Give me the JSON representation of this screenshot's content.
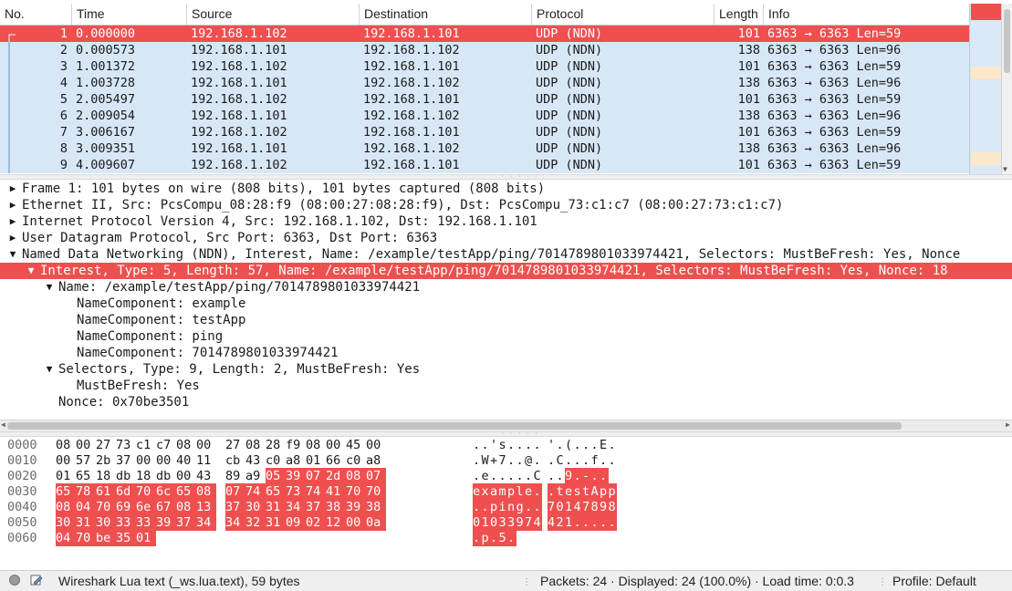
{
  "packet_list": {
    "columns": [
      "No.",
      "Time",
      "Source",
      "Destination",
      "Protocol",
      "Length",
      "Info"
    ],
    "rows": [
      {
        "no": "1",
        "time": "0.000000",
        "src": "192.168.1.102",
        "dst": "192.168.1.101",
        "proto": "UDP (NDN)",
        "len": "101",
        "info": "6363 → 6363 Len=59",
        "selected": true
      },
      {
        "no": "2",
        "time": "0.000573",
        "src": "192.168.1.101",
        "dst": "192.168.1.102",
        "proto": "UDP (NDN)",
        "len": "138",
        "info": "6363 → 6363 Len=96",
        "selected": false
      },
      {
        "no": "3",
        "time": "1.001372",
        "src": "192.168.1.102",
        "dst": "192.168.1.101",
        "proto": "UDP (NDN)",
        "len": "101",
        "info": "6363 → 6363 Len=59",
        "selected": false
      },
      {
        "no": "4",
        "time": "1.003728",
        "src": "192.168.1.101",
        "dst": "192.168.1.102",
        "proto": "UDP (NDN)",
        "len": "138",
        "info": "6363 → 6363 Len=96",
        "selected": false
      },
      {
        "no": "5",
        "time": "2.005497",
        "src": "192.168.1.102",
        "dst": "192.168.1.101",
        "proto": "UDP (NDN)",
        "len": "101",
        "info": "6363 → 6363 Len=59",
        "selected": false
      },
      {
        "no": "6",
        "time": "2.009054",
        "src": "192.168.1.101",
        "dst": "192.168.1.102",
        "proto": "UDP (NDN)",
        "len": "138",
        "info": "6363 → 6363 Len=96",
        "selected": false
      },
      {
        "no": "7",
        "time": "3.006167",
        "src": "192.168.1.102",
        "dst": "192.168.1.101",
        "proto": "UDP (NDN)",
        "len": "101",
        "info": "6363 → 6363 Len=59",
        "selected": false
      },
      {
        "no": "8",
        "time": "3.009351",
        "src": "192.168.1.101",
        "dst": "192.168.1.102",
        "proto": "UDP (NDN)",
        "len": "138",
        "info": "6363 → 6363 Len=96",
        "selected": false
      },
      {
        "no": "9",
        "time": "4.009607",
        "src": "192.168.1.102",
        "dst": "192.168.1.101",
        "proto": "UDP (NDN)",
        "len": "101",
        "info": "6363 → 6363 Len=59",
        "selected": false
      }
    ]
  },
  "details": {
    "items": [
      {
        "text": "Frame 1: 101 bytes on wire (808 bits), 101 bytes captured (808 bits)",
        "level": 0,
        "state": "collapsed",
        "selected": false
      },
      {
        "text": "Ethernet II, Src: PcsCompu_08:28:f9 (08:00:27:08:28:f9), Dst: PcsCompu_73:c1:c7 (08:00:27:73:c1:c7)",
        "level": 0,
        "state": "collapsed",
        "selected": false
      },
      {
        "text": "Internet Protocol Version 4, Src: 192.168.1.102, Dst: 192.168.1.101",
        "level": 0,
        "state": "collapsed",
        "selected": false
      },
      {
        "text": "User Datagram Protocol, Src Port: 6363, Dst Port: 6363",
        "level": 0,
        "state": "collapsed",
        "selected": false
      },
      {
        "text": "Named Data Networking (NDN), Interest, Name: /example/testApp/ping/7014789801033974421, Selectors: MustBeFresh: Yes, Nonce",
        "level": 0,
        "state": "expanded",
        "selected": false
      },
      {
        "text": "Interest, Type: 5, Length: 57, Name: /example/testApp/ping/7014789801033974421, Selectors: MustBeFresh: Yes, Nonce: 18",
        "level": 1,
        "state": "expanded",
        "selected": true
      },
      {
        "text": "Name: /example/testApp/ping/7014789801033974421",
        "level": 2,
        "state": "expanded",
        "selected": false
      },
      {
        "text": "NameComponent: example",
        "level": 3,
        "state": "leaf",
        "selected": false
      },
      {
        "text": "NameComponent: testApp",
        "level": 3,
        "state": "leaf",
        "selected": false
      },
      {
        "text": "NameComponent: ping",
        "level": 3,
        "state": "leaf",
        "selected": false
      },
      {
        "text": "NameComponent: 7014789801033974421",
        "level": 3,
        "state": "leaf",
        "selected": false
      },
      {
        "text": "Selectors, Type: 9, Length: 2, MustBeFresh: Yes",
        "level": 2,
        "state": "expanded",
        "selected": false
      },
      {
        "text": "MustBeFresh: Yes",
        "level": 3,
        "state": "leaf",
        "selected": false
      },
      {
        "text": "Nonce: 0x70be3501",
        "level": 2,
        "state": "leaf",
        "selected": false
      }
    ]
  },
  "bytes": {
    "highlight_start": 42,
    "rows": [
      {
        "offset": "0000",
        "hex": [
          "08",
          "00",
          "27",
          "73",
          "c1",
          "c7",
          "08",
          "00",
          "27",
          "08",
          "28",
          "f9",
          "08",
          "00",
          "45",
          "00"
        ],
        "ascii": "..'s.... '.(...E."
      },
      {
        "offset": "0010",
        "hex": [
          "00",
          "57",
          "2b",
          "37",
          "00",
          "00",
          "40",
          "11",
          "cb",
          "43",
          "c0",
          "a8",
          "01",
          "66",
          "c0",
          "a8"
        ],
        "ascii": ".W+7..@. .C...f.."
      },
      {
        "offset": "0020",
        "hex": [
          "01",
          "65",
          "18",
          "db",
          "18",
          "db",
          "00",
          "43",
          "89",
          "a9",
          "05",
          "39",
          "07",
          "2d",
          "08",
          "07"
        ],
        "ascii": ".e.....C ..9.-.."
      },
      {
        "offset": "0030",
        "hex": [
          "65",
          "78",
          "61",
          "6d",
          "70",
          "6c",
          "65",
          "08",
          "07",
          "74",
          "65",
          "73",
          "74",
          "41",
          "70",
          "70"
        ],
        "ascii": "example. .testApp"
      },
      {
        "offset": "0040",
        "hex": [
          "08",
          "04",
          "70",
          "69",
          "6e",
          "67",
          "08",
          "13",
          "37",
          "30",
          "31",
          "34",
          "37",
          "38",
          "39",
          "38"
        ],
        "ascii": "..ping.. 70147898"
      },
      {
        "offset": "0050",
        "hex": [
          "30",
          "31",
          "30",
          "33",
          "33",
          "39",
          "37",
          "34",
          "34",
          "32",
          "31",
          "09",
          "02",
          "12",
          "00",
          "0a"
        ],
        "ascii": "01033974 421....."
      },
      {
        "offset": "0060",
        "hex": [
          "04",
          "70",
          "be",
          "35",
          "01"
        ],
        "ascii": ".p.5."
      }
    ]
  },
  "status": {
    "field_text": "Wireshark Lua text (_ws.lua.text), 59 bytes",
    "packets_text": "Packets: 24 · Displayed: 24 (100.0%) · Load time: 0:0.3",
    "profile_text": "Profile: Default"
  },
  "colors": {
    "selection": "#ef4f4f",
    "udp_row": "#d7e7f6"
  }
}
